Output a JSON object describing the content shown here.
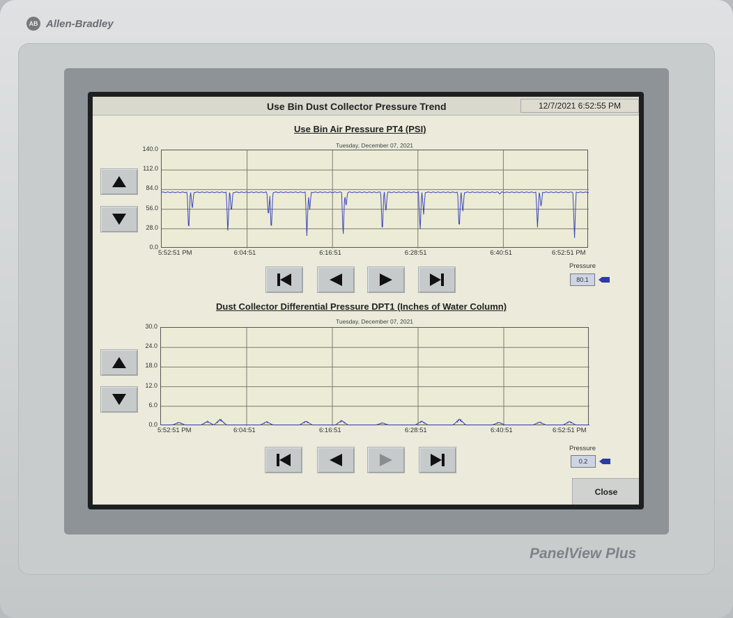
{
  "device": {
    "brand": "Allen-Bradley",
    "brand_logo": "AB",
    "model": "PanelView Plus"
  },
  "screen": {
    "title": "Use Bin Dust Collector Pressure Trend",
    "datetime": "12/7/2021 6:52:55 PM",
    "close_label": "Close"
  },
  "charts": {
    "top": {
      "title": "Use Bin Air Pressure PT4 (PSI)",
      "subtitle": "Tuesday, December 07, 2021",
      "pressure_label": "Pressure",
      "pressure_value": "80.1"
    },
    "bottom": {
      "title": "Dust Collector Differential Pressure DPT1 (Inches of Water Column)",
      "subtitle": "Tuesday, December 07, 2021",
      "pressure_label": "Pressure",
      "pressure_value": "0.2"
    }
  },
  "colors": {
    "trace": "#3a45b8",
    "grid": "#7b7b70",
    "plot_bg": "#ecebd6",
    "pointer": "#2b3aa7"
  },
  "chart_data": [
    {
      "type": "line",
      "title": "Use Bin Air Pressure PT4 (PSI)",
      "subtitle": "Tuesday, December 07, 2021",
      "ylim": [
        0,
        140
      ],
      "yticks": [
        "140.0",
        "112.0",
        "84.0",
        "56.0",
        "28.0",
        "0.0"
      ],
      "xticks": [
        "5:52:51 PM",
        "6:04:51",
        "6:16:51",
        "6:28:51",
        "6:40:51",
        "6:52:51 PM"
      ],
      "xlim": [
        0,
        60
      ],
      "grid": true,
      "series": [
        {
          "baseline": 80.1,
          "dips": [
            {
              "t": 3.8,
              "min": 22
            },
            {
              "t": 4.3,
              "min": 55
            },
            {
              "t": 9.3,
              "min": 20
            },
            {
              "t": 9.8,
              "min": 50
            },
            {
              "t": 15.0,
              "min": 45
            },
            {
              "t": 15.4,
              "min": 22
            },
            {
              "t": 20.4,
              "min": 18
            },
            {
              "t": 20.8,
              "min": 55
            },
            {
              "t": 25.5,
              "min": 15
            },
            {
              "t": 25.9,
              "min": 60
            },
            {
              "t": 31.0,
              "min": 20
            },
            {
              "t": 31.5,
              "min": 52
            },
            {
              "t": 36.3,
              "min": 23
            },
            {
              "t": 36.8,
              "min": 48
            },
            {
              "t": 41.8,
              "min": 25
            },
            {
              "t": 42.3,
              "min": 50
            },
            {
              "t": 47.5,
              "min": 78
            },
            {
              "t": 52.8,
              "min": 30
            },
            {
              "t": 53.3,
              "min": 58
            },
            {
              "t": 58.0,
              "min": 15
            }
          ]
        }
      ]
    },
    {
      "type": "line",
      "title": "Dust Collector Differential Pressure DPT1 (Inches of Water Column)",
      "subtitle": "Tuesday, December 07, 2021",
      "ylim": [
        0,
        30
      ],
      "yticks": [
        "30.0",
        "24.0",
        "18.0",
        "12.0",
        "6.0",
        "0.0"
      ],
      "xticks": [
        "5:52:51 PM",
        "6:04:51",
        "6:16:51",
        "6:28:51",
        "6:40:51",
        "6:52:51 PM"
      ],
      "xlim": [
        0,
        60
      ],
      "grid": true,
      "series": [
        {
          "baseline": 0.3,
          "bumps": [
            {
              "t": 2.5,
              "max": 1.2
            },
            {
              "t": 6.5,
              "max": 1.5
            },
            {
              "t": 8.3,
              "max": 2.2
            },
            {
              "t": 14.8,
              "max": 1.4
            },
            {
              "t": 20.3,
              "max": 1.6
            },
            {
              "t": 25.3,
              "max": 1.8
            },
            {
              "t": 31.0,
              "max": 1.0
            },
            {
              "t": 36.5,
              "max": 1.6
            },
            {
              "t": 41.8,
              "max": 2.3
            },
            {
              "t": 47.3,
              "max": 1.2
            },
            {
              "t": 53.0,
              "max": 1.3
            },
            {
              "t": 57.2,
              "max": 1.5
            }
          ]
        }
      ]
    }
  ]
}
